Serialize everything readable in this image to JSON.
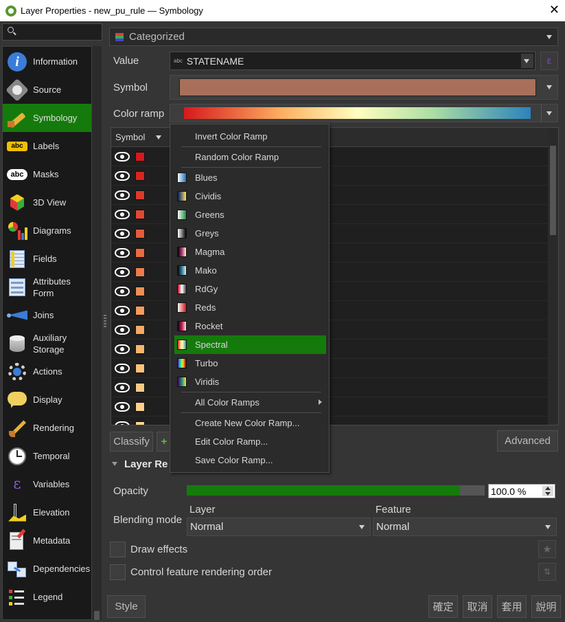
{
  "window": {
    "title": "Layer Properties - new_pu_rule — Symbology"
  },
  "search": {
    "placeholder": ""
  },
  "sidebar": {
    "items": [
      {
        "label": "Information",
        "icon": "info-icon"
      },
      {
        "label": "Source",
        "icon": "source-wrench-icon"
      },
      {
        "label": "Symbology",
        "icon": "symbology-brush-icon",
        "active": true
      },
      {
        "label": "Labels",
        "icon": "labels-abc-icon"
      },
      {
        "label": "Masks",
        "icon": "masks-abc-icon"
      },
      {
        "label": "3D View",
        "icon": "3d-cube-icon"
      },
      {
        "label": "Diagrams",
        "icon": "diagrams-icon"
      },
      {
        "label": "Fields",
        "icon": "fields-icon"
      },
      {
        "label": "Attributes\nForm",
        "icon": "attributes-form-icon"
      },
      {
        "label": "Joins",
        "icon": "joins-icon"
      },
      {
        "label": "Auxiliary\nStorage",
        "icon": "auxiliary-storage-icon"
      },
      {
        "label": "Actions",
        "icon": "actions-gear-icon"
      },
      {
        "label": "Display",
        "icon": "display-speech-icon"
      },
      {
        "label": "Rendering",
        "icon": "rendering-brush-icon"
      },
      {
        "label": "Temporal",
        "icon": "temporal-clock-icon"
      },
      {
        "label": "Variables",
        "icon": "variables-epsilon-icon"
      },
      {
        "label": "Elevation",
        "icon": "elevation-icon"
      },
      {
        "label": "Metadata",
        "icon": "metadata-icon"
      },
      {
        "label": "Dependencies",
        "icon": "dependencies-icon"
      },
      {
        "label": "Legend",
        "icon": "legend-icon"
      }
    ]
  },
  "renderer": {
    "type": "Categorized"
  },
  "value": {
    "label": "Value",
    "field_tag": "abc",
    "field": "STATENAME"
  },
  "symbol": {
    "label": "Symbol",
    "color": "#a8705a"
  },
  "color_ramp": {
    "label": "Color ramp"
  },
  "table": {
    "header": "Symbol",
    "swatches": [
      "#d7191c",
      "#d8261f",
      "#dc3a29",
      "#e04a31",
      "#e45c3a",
      "#e86c41",
      "#ec7d4b",
      "#f08f55",
      "#f39c5c",
      "#f5a964",
      "#f8b56c",
      "#fbc278",
      "#fcc984",
      "#fdd08b",
      "#fdd690"
    ]
  },
  "ramp_menu": {
    "top_items": [
      "Invert Color Ramp",
      "Random Color Ramp"
    ],
    "ramps": [
      {
        "name": "Blues",
        "icon": "blues-ramp-icon"
      },
      {
        "name": "Cividis",
        "icon": "cividis-ramp-icon"
      },
      {
        "name": "Greens",
        "icon": "greens-ramp-icon"
      },
      {
        "name": "Greys",
        "icon": "greys-ramp-icon"
      },
      {
        "name": "Magma",
        "icon": "magma-ramp-icon"
      },
      {
        "name": "Mako",
        "icon": "mako-ramp-icon"
      },
      {
        "name": "RdGy",
        "icon": "rdgy-ramp-icon"
      },
      {
        "name": "Reds",
        "icon": "reds-ramp-icon"
      },
      {
        "name": "Rocket",
        "icon": "rocket-ramp-icon"
      },
      {
        "name": "Spectral",
        "icon": "spectral-ramp-icon",
        "selected": true
      },
      {
        "name": "Turbo",
        "icon": "turbo-ramp-icon"
      },
      {
        "name": "Viridis",
        "icon": "viridis-ramp-icon"
      }
    ],
    "all_ramps": "All Color Ramps",
    "bottom_items": [
      "Create New Color Ramp...",
      "Edit Color Ramp...",
      "Save Color Ramp..."
    ]
  },
  "buttons": {
    "classify": "Classify",
    "advanced": "Advanced",
    "style": "Style",
    "ok": "確定",
    "cancel": "取消",
    "apply": "套用",
    "help": "說明"
  },
  "layer_rendering": {
    "section_title": "Layer Re",
    "opacity_label": "Opacity",
    "opacity_value": "100.0 %",
    "opacity_fraction": 1.0,
    "blending_label": "Blending mode",
    "layer_label": "Layer",
    "layer_value": "Normal",
    "feature_label": "Feature",
    "feature_value": "Normal",
    "draw_effects": "Draw effects",
    "control_order": "Control feature rendering order"
  },
  "colors": {
    "accent": "#157a0c"
  }
}
